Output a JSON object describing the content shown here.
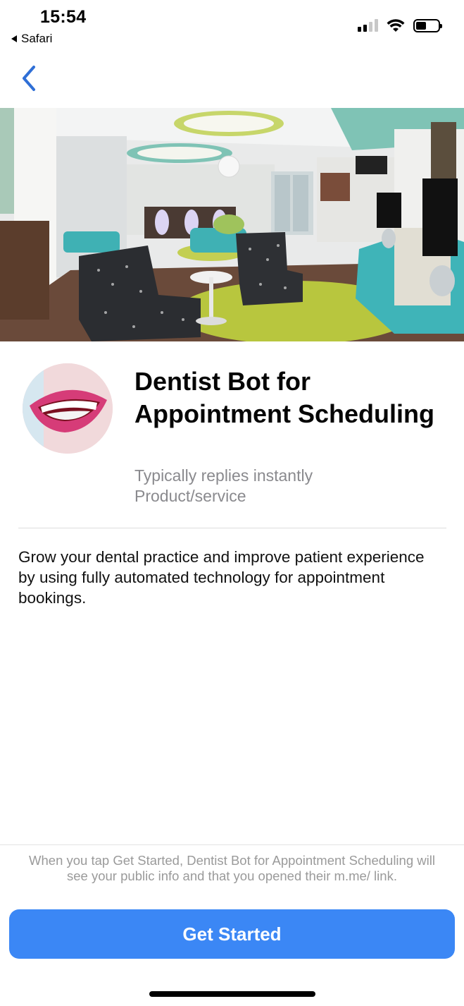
{
  "status_bar": {
    "time": "15:54",
    "back_app": "Safari",
    "battery_level": 0.45,
    "signal_bars_active": 2,
    "signal_bars_total": 4
  },
  "nav": {
    "back_icon": "chevron-left-icon",
    "accent": "#2f6fd6"
  },
  "hero": {
    "image_icon": "waiting-room-photo"
  },
  "profile": {
    "avatar_icon": "smile-teeth-avatar",
    "name": "Dentist Bot for Appointment Scheduling",
    "response_time": "Typically replies instantly",
    "category": "Product/service"
  },
  "about": {
    "description": "Grow your dental practice and improve patient experience by using fully automated technology for appointment bookings."
  },
  "footer": {
    "consent_text": "When you tap Get Started, Dentist Bot for Appointment Scheduling will see your public info and that you opened their m.me/ link.",
    "cta_label": "Get Started",
    "cta_color": "#3b87f5"
  }
}
